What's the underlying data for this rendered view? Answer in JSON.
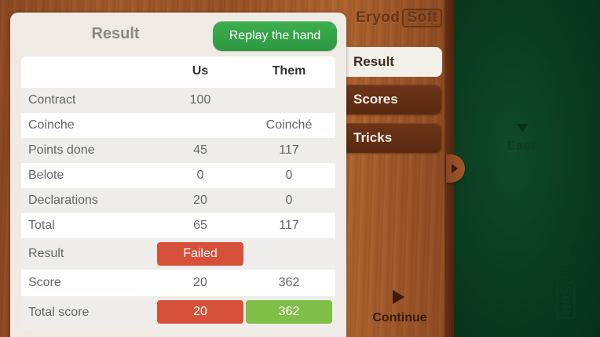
{
  "logo": {
    "part1": "Eryod",
    "part2": "Soft"
  },
  "panel": {
    "title": "Result",
    "replay_label": "Replay the hand"
  },
  "table": {
    "headers": [
      "",
      "Us",
      "Them"
    ],
    "rows": [
      {
        "label": "Contract",
        "us": "100",
        "them": ""
      },
      {
        "label": "Coinche",
        "us": "",
        "them": "Coinché"
      },
      {
        "label": "Points done",
        "us": "45",
        "them": "117"
      },
      {
        "label": "Belote",
        "us": "0",
        "them": "0"
      },
      {
        "label": "Declarations",
        "us": "20",
        "them": "0"
      },
      {
        "label": "Total",
        "us": "65",
        "them": "117"
      },
      {
        "label": "Result",
        "us": "Failed",
        "them": ""
      },
      {
        "label": "Score",
        "us": "20",
        "them": "362"
      },
      {
        "label": "Total score",
        "us": "20",
        "them": "362"
      }
    ]
  },
  "tabs": {
    "result": "Result",
    "scores": "Scores",
    "tricks": "Tricks"
  },
  "continue_label": "Continue",
  "east_label": "East",
  "colors": {
    "failed": "#d7503a",
    "win": "#7fbf47",
    "replay": "#3cae4f",
    "felt": "#0a3a20"
  }
}
